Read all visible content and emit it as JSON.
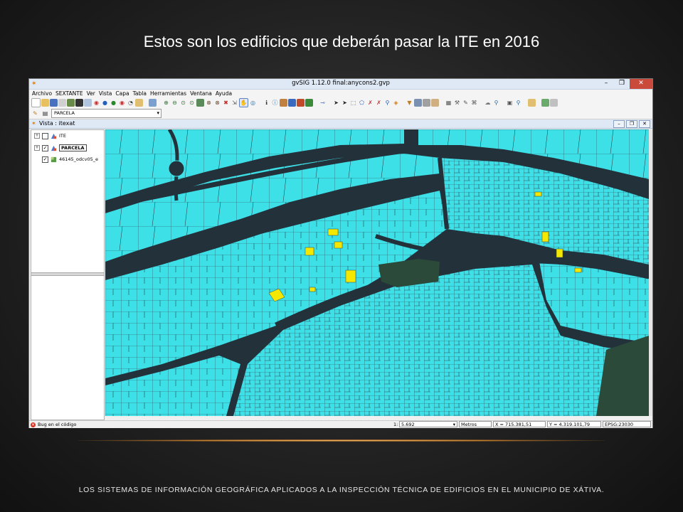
{
  "slide": {
    "title": "Estos son los edificios que deberán pasar la ITE en 2016",
    "footer": "LOS SISTEMAS DE INFORMACIÓN GEOGRÁFICA APLICADOS A LA INSPECCIÓN TÉCNICA DE EDIFICIOS EN EL MUNICIPIO DE XÁTIVA."
  },
  "app": {
    "title": "gvSIG 1.12.0 final:anycons2.gvp",
    "window_buttons": [
      "–",
      "❐",
      "✕"
    ],
    "menu": [
      "Archivo",
      "SEXTANTE",
      "Ver",
      "Vista",
      "Capa",
      "Tabla",
      "Herramientas",
      "Ventana",
      "Ayuda"
    ],
    "active_layer_select": "PARCELA",
    "view_title": "Vista : itexat",
    "view_buttons": [
      "–",
      "❐",
      "✕"
    ],
    "toc": {
      "layers": [
        {
          "name": "ITE",
          "checked": false,
          "icon": "vector-layer-icon"
        },
        {
          "name": "PARCELA",
          "checked": true,
          "icon": "vector-layer-icon",
          "selected": true
        },
        {
          "name": "46145_odcv05_e",
          "checked": true,
          "icon": "raster-layer-icon"
        }
      ]
    },
    "status": {
      "message": "Bug en el código",
      "scale_prefix": "1:",
      "scale": "5.692",
      "units": "Metros",
      "x": "X = 715.381,51",
      "y": "Y = 4.319.101,79",
      "epsg": "EPSG:23030"
    },
    "colors": {
      "parcel_fill": "#3ee0e8",
      "ite_fill": "#f5e800",
      "street": "#2a3a40"
    }
  }
}
